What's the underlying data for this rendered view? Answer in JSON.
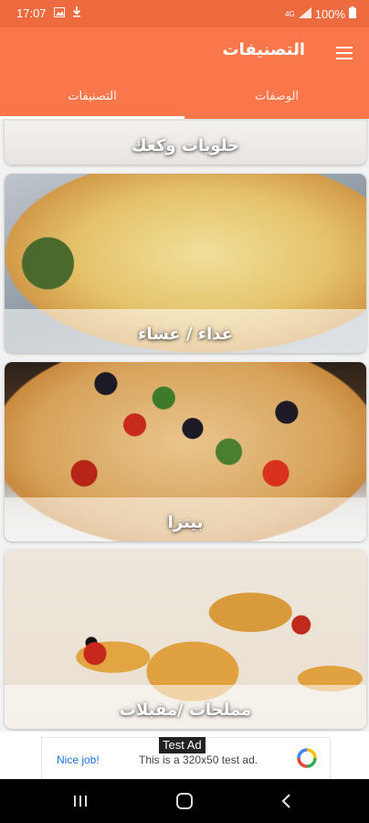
{
  "status_bar": {
    "time": "17:07",
    "network": "4G",
    "battery": "100%"
  },
  "toolbar": {
    "title": "التصنيفات"
  },
  "tabs": [
    {
      "label": "الوصفات"
    },
    {
      "label": "التصنيفات"
    }
  ],
  "categories": [
    {
      "name": "حلويات وكعك"
    },
    {
      "name": "غداء / عشاء"
    },
    {
      "name": "بيتزا"
    },
    {
      "name": "مملحات /مقبلات"
    }
  ],
  "ad": {
    "badge": "Test Ad",
    "cta": "Nice job!",
    "text": "This is a 320x50 test ad."
  },
  "colors": {
    "toolbar": "#f9774a",
    "status_bar": "#ee6b3f",
    "nav_bar": "#000000"
  }
}
